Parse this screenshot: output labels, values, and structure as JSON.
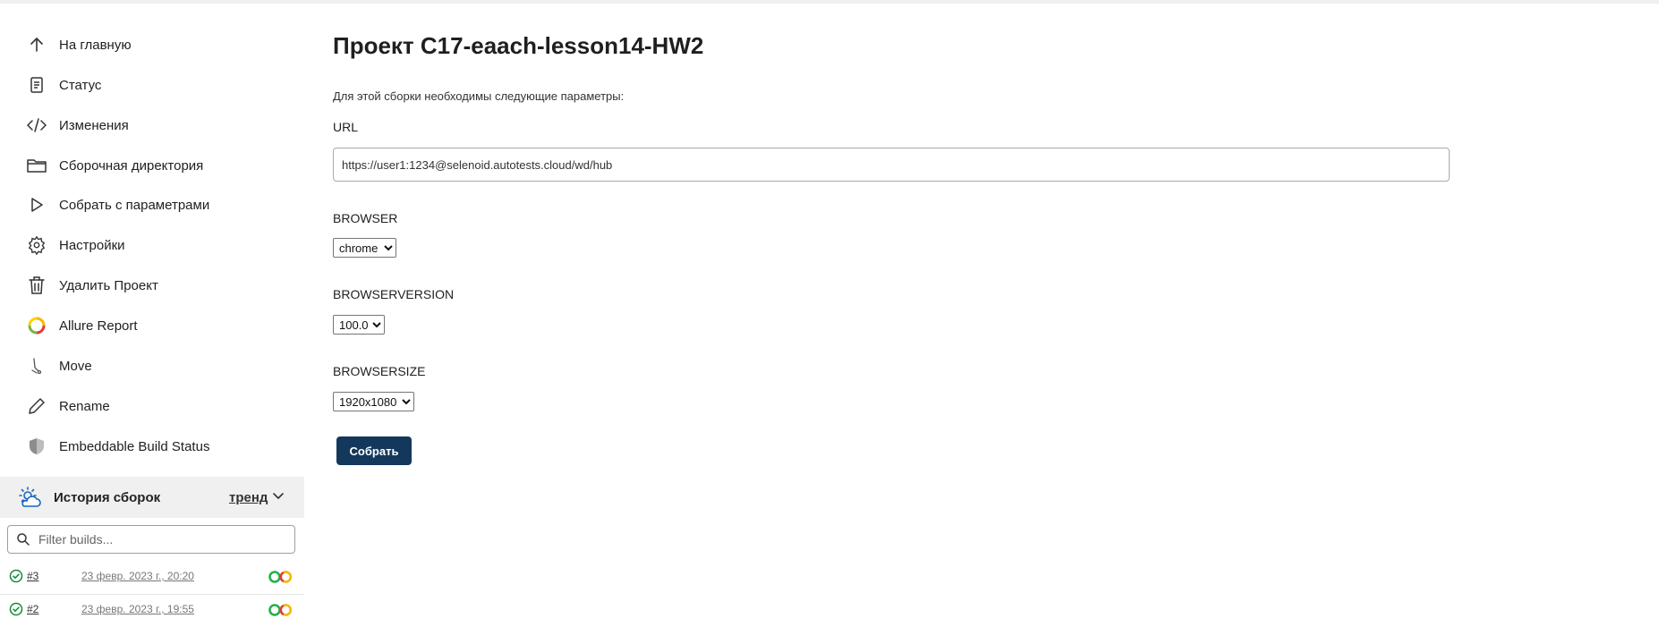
{
  "sidebar": {
    "items": [
      {
        "label": "На главную",
        "icon": "arrow-up-icon"
      },
      {
        "label": "Статус",
        "icon": "document-icon"
      },
      {
        "label": "Изменения",
        "icon": "code-icon"
      },
      {
        "label": "Сборочная директория",
        "icon": "folder-icon"
      },
      {
        "label": "Собрать с параметрами",
        "icon": "play-icon"
      },
      {
        "label": "Настройки",
        "icon": "gear-icon"
      },
      {
        "label": "Удалить Проект",
        "icon": "trash-icon"
      },
      {
        "label": "Allure Report",
        "icon": "allure-icon"
      },
      {
        "label": "Move",
        "icon": "move-icon"
      },
      {
        "label": "Rename",
        "icon": "pencil-icon"
      },
      {
        "label": "Embeddable Build Status",
        "icon": "shield-icon"
      }
    ]
  },
  "history": {
    "title": "История сборок",
    "trend_label": "тренд",
    "filter_placeholder": "Filter builds...",
    "builds": [
      {
        "number": "#3",
        "date": "23 февр. 2023 г., 20:20"
      },
      {
        "number": "#2",
        "date": "23 февр. 2023 г., 19:55"
      }
    ]
  },
  "main": {
    "title": "Проект C17-eaach-lesson14-HW2",
    "description": "Для этой сборки необходимы следующие параметры:",
    "params": {
      "url": {
        "label": "URL",
        "value": "https://user1:1234@selenoid.autotests.cloud/wd/hub"
      },
      "browser": {
        "label": "BROWSER",
        "value": "chrome"
      },
      "browser_version": {
        "label": "BROWSERVERSION",
        "value": "100.0"
      },
      "browser_size": {
        "label": "BROWSERSIZE",
        "value": "1920x1080"
      }
    },
    "build_button": "Собрать"
  },
  "colors": {
    "primary_button": "#14385c",
    "success": "#138a36",
    "history_bg": "#f0f0f0"
  }
}
